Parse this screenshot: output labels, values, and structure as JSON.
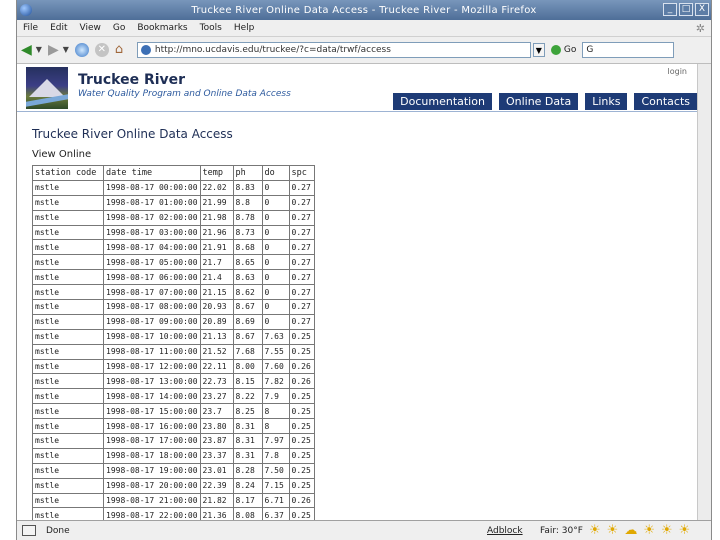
{
  "window": {
    "title": "Truckee River Online Data Access - Truckee River - Mozilla Firefox",
    "buttons": [
      "_",
      "□",
      "X"
    ]
  },
  "menu": [
    "File",
    "Edit",
    "View",
    "Go",
    "Bookmarks",
    "Tools",
    "Help"
  ],
  "toolbar": {
    "url": "http://mno.ucdavis.edu/truckee/?c=data/trwf/access",
    "go_label": "Go",
    "search_value": "G"
  },
  "site": {
    "title": "Truckee River",
    "subtitle": "Water Quality Program and Online Data Access",
    "login": "login",
    "nav": [
      "Documentation",
      "Online Data",
      "Links",
      "Contacts"
    ]
  },
  "page": {
    "title": "Truckee River Online Data Access",
    "section": "View Online"
  },
  "table": {
    "headers": [
      "station code",
      "date time",
      "temp",
      "ph",
      "do",
      "spc"
    ],
    "rows": [
      [
        "mstle",
        "1998-08-17 00:00:00",
        "22.02",
        "8.83",
        "0",
        "0.27"
      ],
      [
        "mstle",
        "1998-08-17 01:00:00",
        "21.99",
        "8.8",
        "0",
        "0.27"
      ],
      [
        "mstle",
        "1998-08-17 02:00:00",
        "21.98",
        "8.78",
        "0",
        "0.27"
      ],
      [
        "mstle",
        "1998-08-17 03:00:00",
        "21.96",
        "8.73",
        "0",
        "0.27"
      ],
      [
        "mstle",
        "1998-08-17 04:00:00",
        "21.91",
        "8.68",
        "0",
        "0.27"
      ],
      [
        "mstle",
        "1998-08-17 05:00:00",
        "21.7",
        "8.65",
        "0",
        "0.27"
      ],
      [
        "mstle",
        "1998-08-17 06:00:00",
        "21.4",
        "8.63",
        "0",
        "0.27"
      ],
      [
        "mstle",
        "1998-08-17 07:00:00",
        "21.15",
        "8.62",
        "0",
        "0.27"
      ],
      [
        "mstle",
        "1998-08-17 08:00:00",
        "20.93",
        "8.67",
        "0",
        "0.27"
      ],
      [
        "mstle",
        "1998-08-17 09:00:00",
        "20.89",
        "8.69",
        "0",
        "0.27"
      ],
      [
        "mstle",
        "1998-08-17 10:00:00",
        "21.13",
        "8.67",
        "7.63",
        "0.25"
      ],
      [
        "mstle",
        "1998-08-17 11:00:00",
        "21.52",
        "7.68",
        "7.55",
        "0.25"
      ],
      [
        "mstle",
        "1998-08-17 12:00:00",
        "22.11",
        "8.00",
        "7.60",
        "0.26"
      ],
      [
        "mstle",
        "1998-08-17 13:00:00",
        "22.73",
        "8.15",
        "7.82",
        "0.26"
      ],
      [
        "mstle",
        "1998-08-17 14:00:00",
        "23.27",
        "8.22",
        "7.9",
        "0.25"
      ],
      [
        "mstle",
        "1998-08-17 15:00:00",
        "23.7",
        "8.25",
        "8",
        "0.25"
      ],
      [
        "mstle",
        "1998-08-17 16:00:00",
        "23.80",
        "8.31",
        "8",
        "0.25"
      ],
      [
        "mstle",
        "1998-08-17 17:00:00",
        "23.87",
        "8.31",
        "7.97",
        "0.25"
      ],
      [
        "mstle",
        "1998-08-17 18:00:00",
        "23.37",
        "8.31",
        "7.8",
        "0.25"
      ],
      [
        "mstle",
        "1998-08-17 19:00:00",
        "23.01",
        "8.28",
        "7.50",
        "0.25"
      ],
      [
        "mstle",
        "1998-08-17 20:00:00",
        "22.39",
        "8.24",
        "7.15",
        "0.25"
      ],
      [
        "mstle",
        "1998-08-17 21:00:00",
        "21.82",
        "8.17",
        "6.71",
        "0.26"
      ],
      [
        "mstle",
        "1998-08-17 22:00:00",
        "21.36",
        "8.08",
        "6.37",
        "0.25"
      ]
    ]
  },
  "status": {
    "text": "Done",
    "adblock": "Adblock",
    "weather": "Fair: 30°F"
  }
}
